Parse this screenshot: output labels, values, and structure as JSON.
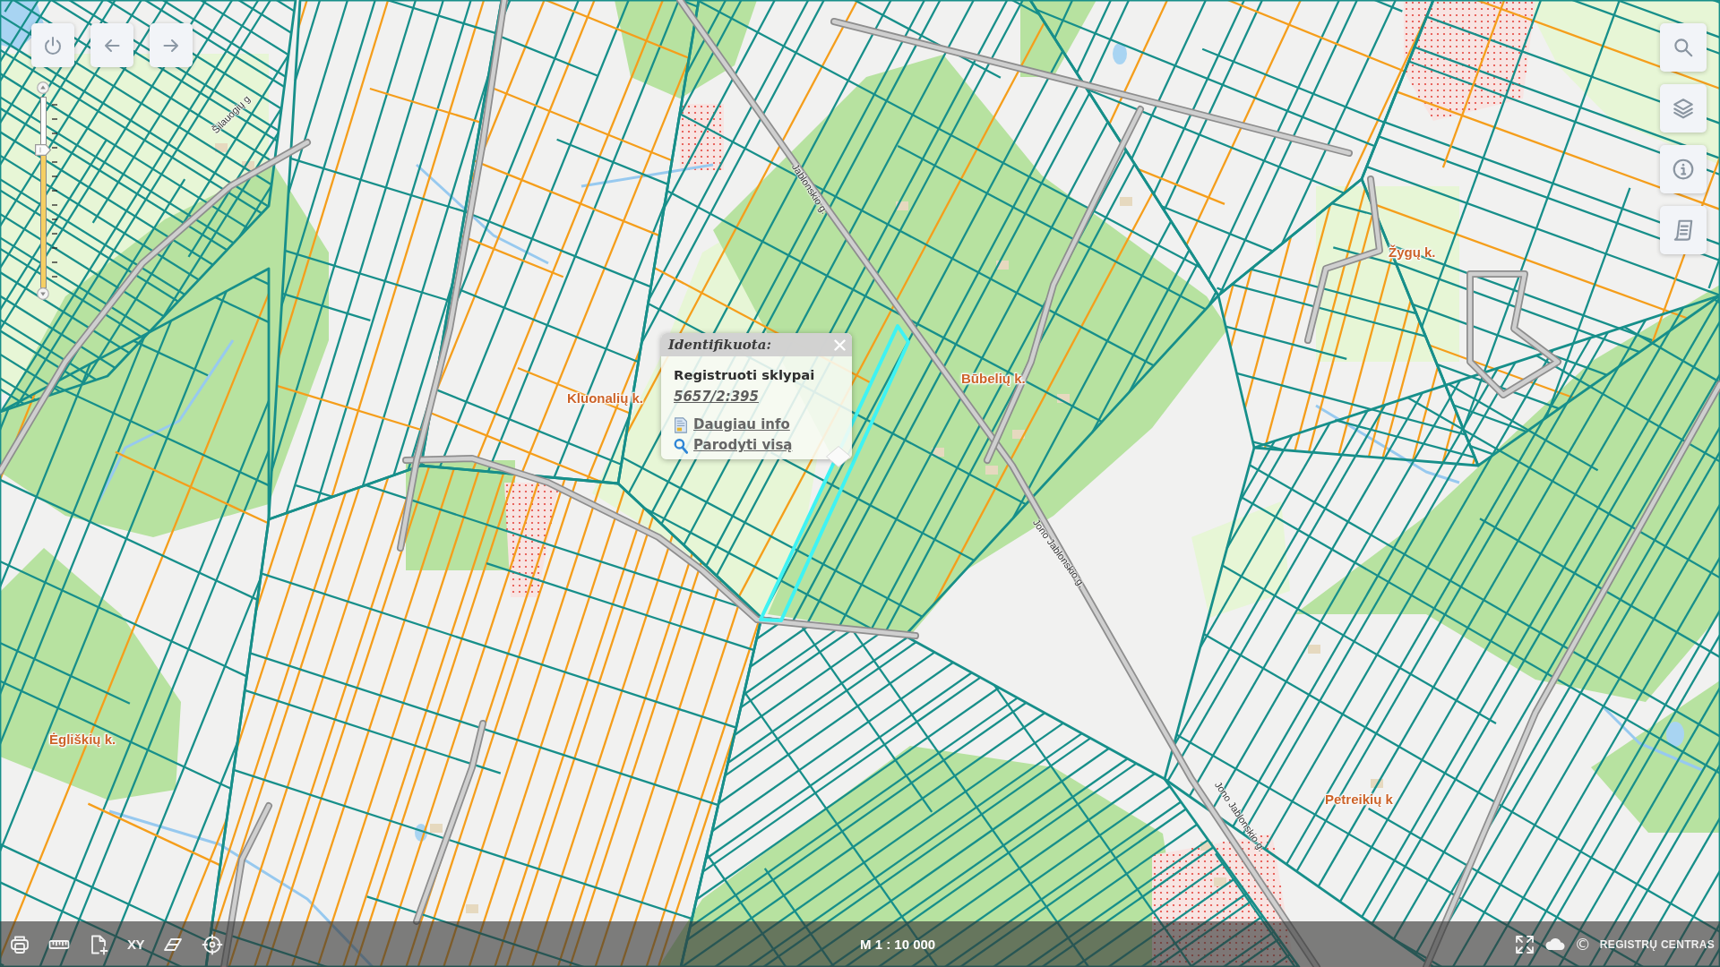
{
  "map_controls": [
    {
      "kind": "power"
    },
    {
      "kind": "back"
    },
    {
      "kind": "forward"
    }
  ],
  "zoom_slider": {
    "level": 0.72
  },
  "map": {
    "place_labels": [
      {
        "text": "Žygų k."
      },
      {
        "text": "Būbelių k."
      },
      {
        "text": "Kluonalių k."
      },
      {
        "text": "Ėgliškių k."
      },
      {
        "text": "Petreikių k"
      }
    ],
    "street_labels": [
      {
        "text": "Šilauogių g"
      },
      {
        "text": "Jablonskio g."
      },
      {
        "text": "Jono Jablonskio g."
      },
      {
        "text": "Jono Jablonskio g."
      }
    ]
  },
  "side_toolbar": [
    {
      "kind": "search"
    },
    {
      "kind": "layers"
    },
    {
      "kind": "info"
    },
    {
      "kind": "legend"
    }
  ],
  "popup": {
    "title": "Identifikuota:",
    "layer": "Registruoti sklypai",
    "parcel_link": "5657/2:395",
    "links": [
      {
        "kind": "info",
        "label": "Daugiau info"
      },
      {
        "kind": "zoom",
        "label": "Parodyti visą"
      }
    ]
  },
  "bottom_bar": {
    "tools": [
      {
        "kind": "print"
      },
      {
        "kind": "measure"
      },
      {
        "kind": "add-document"
      },
      {
        "kind": "coordinates",
        "label": "XY"
      },
      {
        "kind": "erase"
      },
      {
        "kind": "locate"
      }
    ],
    "scale": "M 1 : 10 000",
    "view_tools": [
      {
        "kind": "fullscreen"
      },
      {
        "kind": "basemap"
      }
    ],
    "copyright": {
      "symbol": "©",
      "holder": "REGISTRŲ CENTRAS"
    }
  }
}
